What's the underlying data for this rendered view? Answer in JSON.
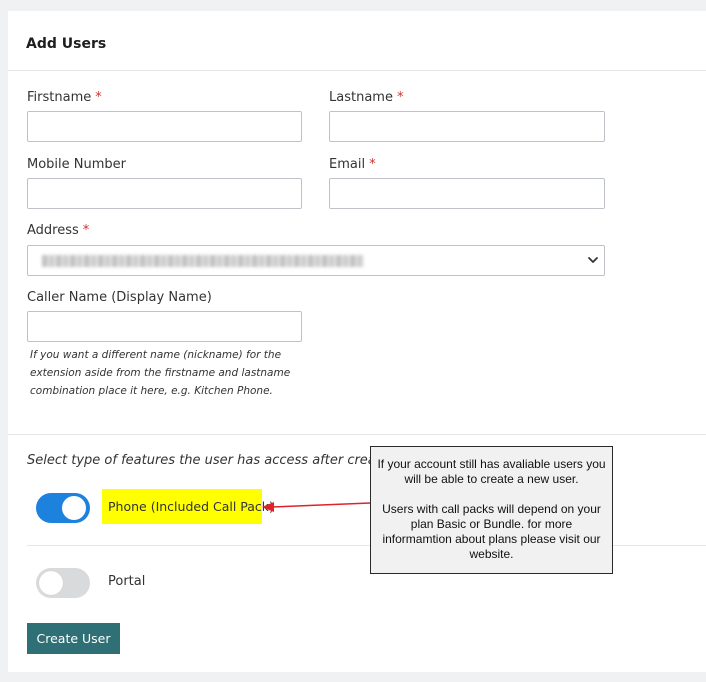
{
  "form": {
    "title": "Add Users",
    "required_marker": "*",
    "firstname": {
      "label": "Firstname",
      "value": ""
    },
    "lastname": {
      "label": "Lastname",
      "value": ""
    },
    "mobile": {
      "label": "Mobile Number",
      "value": ""
    },
    "email": {
      "label": "Email",
      "value": ""
    },
    "address": {
      "label": "Address",
      "selected_value": "(address redacted / blurred)"
    },
    "caller_name": {
      "label": "Caller Name (Display Name)",
      "value": "",
      "hint_lines": [
        "If you want a different name (nickname) for the",
        "extension aside from the firstname and lastname",
        "combination place it here, e.g. Kitchen Phone."
      ]
    }
  },
  "features": {
    "section_label": "Select type of features the user has access after creation.",
    "phone": {
      "label": "Phone (Included Call Pack)",
      "enabled": true,
      "highlight_color": "#ffff00"
    },
    "portal": {
      "label": "Portal",
      "enabled": false
    }
  },
  "actions": {
    "create_user_label": "Create User"
  },
  "callout": {
    "paragraph_1": "If your account still has avaliable users you will be able to create a new user.",
    "paragraph_2": "Users with call packs will depend on your plan Basic or Bundle. for more informamtion about plans please visit our website."
  },
  "colors": {
    "toggle_on": "#1d82dd",
    "toggle_off": "#d9dadc",
    "primary_button": "#2f6f76",
    "required": "#d0312d",
    "arrow": "#e0222a"
  }
}
